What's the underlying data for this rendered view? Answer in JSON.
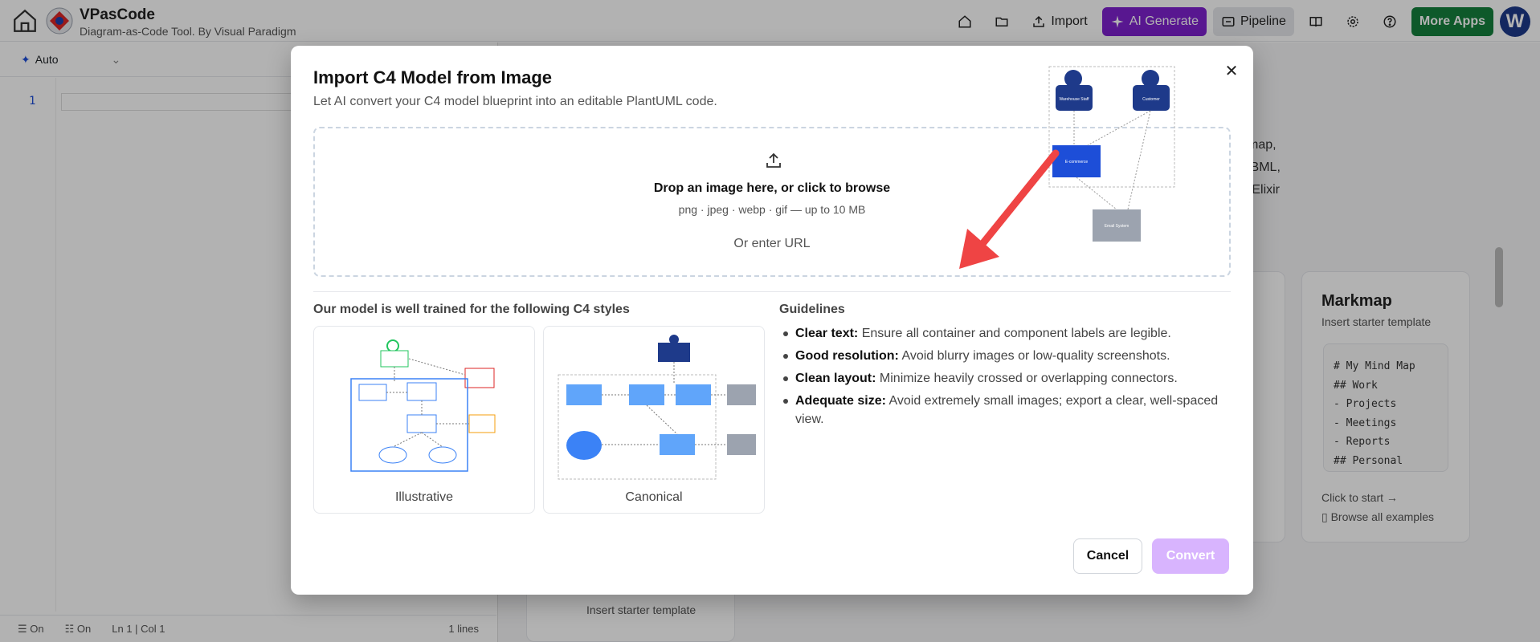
{
  "app": {
    "name": "VPasCode",
    "tagline": "Diagram-as-Code Tool. By Visual Paradigm",
    "avatar_letter": "W"
  },
  "nav": {
    "import": "Import",
    "ai_generate": "AI Generate",
    "pipeline": "Pipeline",
    "more_apps": "More Apps"
  },
  "editor": {
    "mode": "Auto",
    "line_number": "1"
  },
  "status_bar": {
    "wrap": "On",
    "minimap": "On",
    "cursor": "Ln 1 | Col 1",
    "lines": "1 lines"
  },
  "background": {
    "formats_text": [
      "kmap,",
      "DBML,",
      "d Elixir"
    ],
    "markmap_card": {
      "title": "Markmap",
      "subtitle": "Insert starter template",
      "code": [
        "# My Mind Map",
        "## Work",
        "- Projects",
        "- Meetings",
        "- Reports",
        "## Personal"
      ],
      "start_link": "Click to start →",
      "browse_link": "Browse all examples"
    },
    "other_card_subtitle": "Insert starter template"
  },
  "modal": {
    "title": "Import C4 Model from Image",
    "subtitle": "Let AI convert your C4 model blueprint into an editable PlantUML code.",
    "drop_title": "Drop an image here, or click to browse",
    "drop_formats": "png · jpeg · webp · gif — up to 10 MB",
    "drop_url": "Or enter URL",
    "styles_heading": "Our model is well trained for the following C4 styles",
    "styles": [
      {
        "label": "Illustrative"
      },
      {
        "label": "Canonical"
      }
    ],
    "guidelines_heading": "Guidelines",
    "guidelines": [
      {
        "term": "Clear text:",
        "text": "Ensure all container and component labels are legible."
      },
      {
        "term": "Good resolution:",
        "text": "Avoid blurry images or low-quality screenshots."
      },
      {
        "term": "Clean layout:",
        "text": "Minimize heavily crossed or overlapping connectors."
      },
      {
        "term": "Adequate size:",
        "text": "Avoid extremely small images; export a clear, well-spaced view."
      }
    ],
    "cancel": "Cancel",
    "convert": "Convert",
    "hint_diagram": {
      "nodes": [
        "Warehouse Staff",
        "Customer",
        "E-commerce",
        "Email System"
      ]
    }
  },
  "colors": {
    "accent": "#7e22ce",
    "convert_disabled": "#d8b4fe",
    "more_apps": "#15803d",
    "avatar": "#1e3a8a"
  }
}
